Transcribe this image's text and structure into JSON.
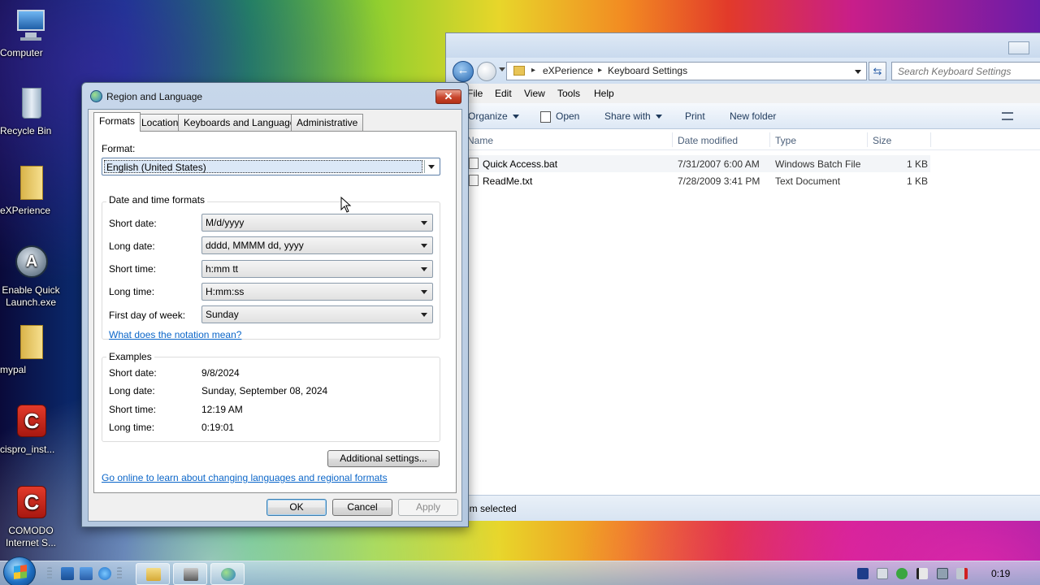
{
  "desktop": {
    "icons": [
      {
        "label": "Computer"
      },
      {
        "label": "Recycle Bin"
      },
      {
        "label": "eXPerience"
      },
      {
        "label": "Enable Quick Launch.exe"
      },
      {
        "label": "mypal"
      },
      {
        "label": "cispro_inst..."
      },
      {
        "label": "COMODO Internet S..."
      }
    ]
  },
  "explorer": {
    "breadcrumb": [
      "eXPerience",
      "Keyboard Settings"
    ],
    "search_placeholder": "Search Keyboard Settings",
    "menu": [
      "File",
      "Edit",
      "View",
      "Tools",
      "Help"
    ],
    "commands": {
      "organize": "Organize",
      "open": "Open",
      "share_with": "Share with",
      "print": "Print",
      "new_folder": "New folder"
    },
    "columns": {
      "name": "Name",
      "date": "Date modified",
      "type": "Type",
      "size": "Size"
    },
    "files": [
      {
        "name": "Quick Access.bat",
        "date": "7/31/2007 6:00 AM",
        "type": "Windows Batch File",
        "size": "1 KB"
      },
      {
        "name": "ReadMe.txt",
        "date": "7/28/2009 3:41 PM",
        "type": "Text Document",
        "size": "1 KB"
      }
    ],
    "status": "em selected"
  },
  "dialog": {
    "title": "Region and Language",
    "close": "✕",
    "tabs": [
      "Formats",
      "Location",
      "Keyboards and Languages",
      "Administrative"
    ],
    "format_label": "Format:",
    "format_value": "English (United States)",
    "datetime_group": "Date and time formats",
    "fields": [
      {
        "label": "Short date:",
        "value": "M/d/yyyy"
      },
      {
        "label": "Long date:",
        "value": "dddd, MMMM dd, yyyy"
      },
      {
        "label": "Short time:",
        "value": "h:mm tt"
      },
      {
        "label": "Long time:",
        "value": "H:mm:ss"
      },
      {
        "label": "First day of week:",
        "value": "Sunday"
      }
    ],
    "notation_link": "What does the notation mean?",
    "examples_group": "Examples",
    "examples": [
      {
        "label": "Short date:",
        "value": "9/8/2024"
      },
      {
        "label": "Long date:",
        "value": "Sunday, September 08, 2024"
      },
      {
        "label": "Short time:",
        "value": "12:19 AM"
      },
      {
        "label": "Long time:",
        "value": "0:19:01"
      }
    ],
    "additional_settings": "Additional settings...",
    "online_link": "Go online to learn about changing languages and regional formats",
    "ok": "OK",
    "cancel": "Cancel",
    "apply": "Apply"
  },
  "taskbar": {
    "clock": "0:19"
  }
}
